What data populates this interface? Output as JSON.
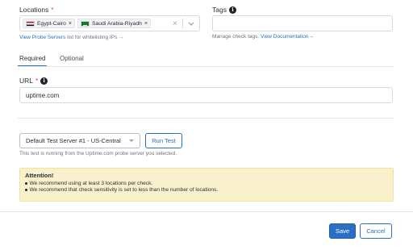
{
  "locations": {
    "label": "Locations",
    "required_mark": "*",
    "selected": [
      {
        "label": "Egypt-Cairo",
        "flag": "egypt-flag"
      },
      {
        "label": "Saudi Arabia-Riyadh",
        "flag": "saudi-arabia-flag"
      }
    ],
    "clear_symbol": "×",
    "remove_symbol": "×",
    "help_link": "View Probe Servers",
    "help_text": "list for whitelisting IPs",
    "help_arrow": "→"
  },
  "tags": {
    "label": "Tags",
    "value": "",
    "hint": "Manage check tags.",
    "doc_link": "View Documentation",
    "doc_arrow": "→"
  },
  "tabs": [
    {
      "label": "Required",
      "active": true
    },
    {
      "label": "Optional",
      "active": false
    }
  ],
  "url": {
    "label": "URL",
    "required_mark": "*",
    "value": "uptime.com"
  },
  "test_server": {
    "selected": "Default Test Server #1 - US-Central",
    "run_label": "Run Test",
    "note": "This test is running from the Uptime.com probe server you selected."
  },
  "attention": {
    "title": "Attention!",
    "items": [
      "We recommend using at least 3 locations per check.",
      "We recommend that check sensitivity is set to less than the number of locations."
    ]
  },
  "footer": {
    "save_label": "Save",
    "cancel_label": "Cancel"
  },
  "colors": {
    "accent": "#2b6fc4",
    "alert_bg": "#f8f1cc"
  }
}
